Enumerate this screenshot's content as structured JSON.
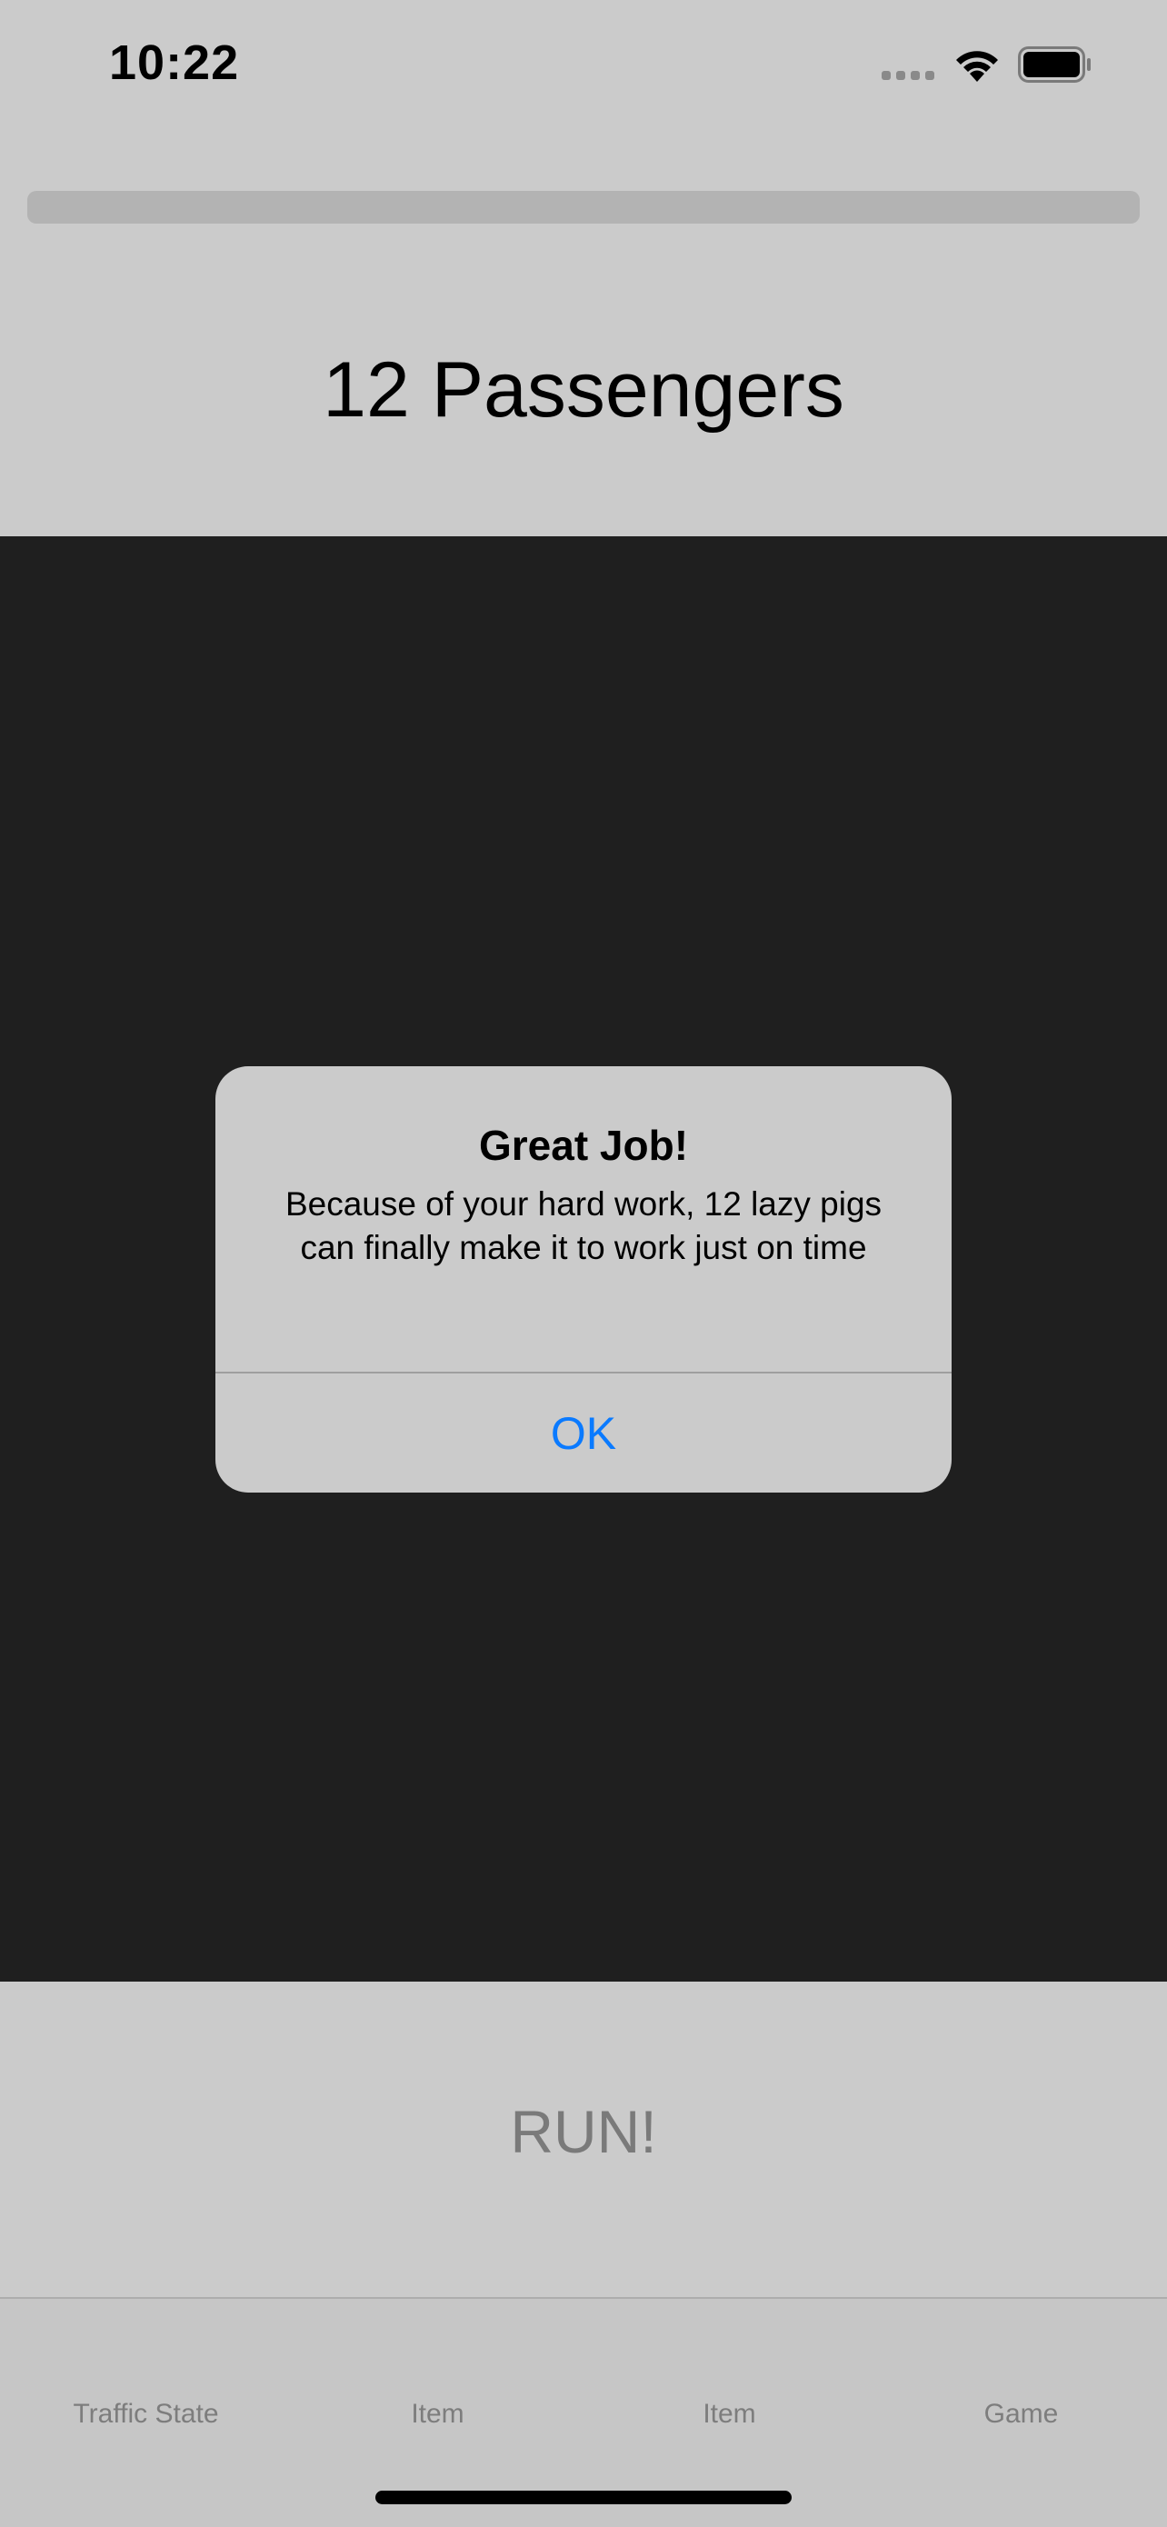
{
  "status_bar": {
    "time": "10:22"
  },
  "icons": {
    "signal": "signal-dots-icon",
    "wifi": "wifi-icon",
    "battery": "battery-icon"
  },
  "progress": {
    "value": 0
  },
  "header": {
    "title": "12 Passengers"
  },
  "main": {
    "run_label": "RUN!"
  },
  "alert": {
    "title": "Great Job!",
    "message": "Because of your hard work, 12 lazy pigs can finally make it to work just on time",
    "ok_label": "OK"
  },
  "tab_bar": {
    "items": [
      {
        "label": "Traffic State"
      },
      {
        "label": "Item"
      },
      {
        "label": "Item"
      },
      {
        "label": "Game"
      }
    ]
  },
  "colors": {
    "background": "#cbcbcb",
    "game_area": "#1f1f1f",
    "accent": "#0a7aff",
    "tab_bar": "#c6c6c6"
  }
}
